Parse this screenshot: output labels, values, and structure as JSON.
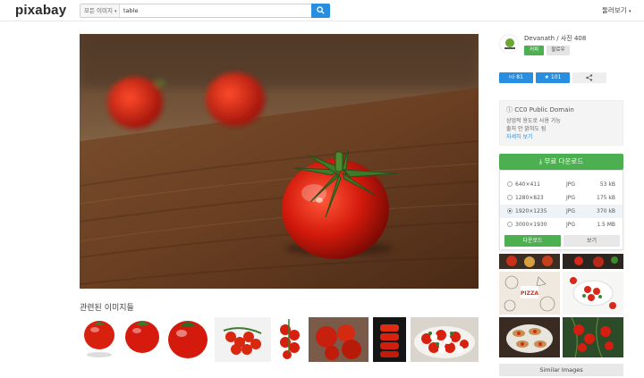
{
  "header": {
    "logo": "pixabay",
    "search_type": "모든 이미지",
    "search_value": "table",
    "explore": "둘러보기"
  },
  "author": {
    "name": "Devanath / 사진 408",
    "coffee": "커피",
    "follow": "팔로우"
  },
  "stats": {
    "likes": "81",
    "favorites": "101"
  },
  "license": {
    "title": "CC0 Public Domain",
    "line1": "상업적 용도로 사용 가능",
    "line2": "출처 안 밝혀도 됨",
    "more": "자세히 보기"
  },
  "download": {
    "button": "무료 다운로드",
    "options": [
      {
        "size": "640×411",
        "format": "JPG",
        "filesize": "53 kB",
        "selected": false
      },
      {
        "size": "1280×823",
        "format": "JPG",
        "filesize": "175 kB",
        "selected": false
      },
      {
        "size": "1920×1235",
        "format": "JPG",
        "filesize": "370 kB",
        "selected": true
      },
      {
        "size": "3000×1930",
        "format": "JPG",
        "filesize": "1.5 MB",
        "selected": false
      }
    ],
    "download_label": "다운로드",
    "view_label": "보기"
  },
  "related": {
    "title": "관련된 이미지들"
  },
  "similar_images": "Similar Images",
  "colors": {
    "accent_blue": "#2a8ee0",
    "accent_green": "#4caf50"
  }
}
